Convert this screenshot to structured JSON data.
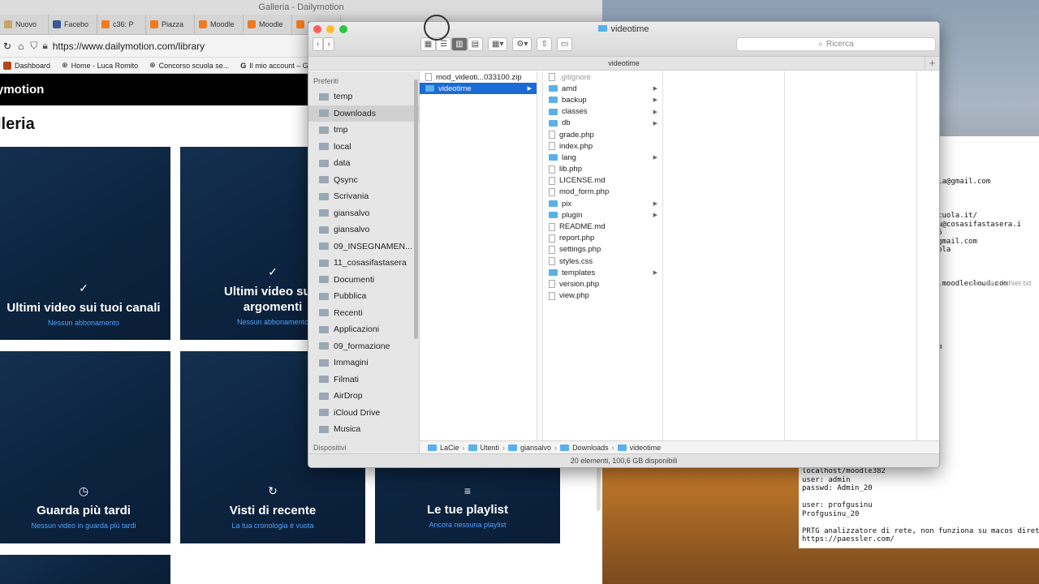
{
  "browser": {
    "window_title": "Galleria - Dailymotion",
    "tabs": [
      "Nuovo",
      "Facebo",
      "c36: P",
      "Piazza",
      "Moodle",
      "Moodle",
      "M"
    ],
    "url": "https://www.dailymotion.com/library",
    "bookmarks": [
      "Dashboard",
      "Home - Luca Romito",
      "Concorso scuola se...",
      "Il mio account – G"
    ],
    "brand": "ymotion",
    "page_title": "lleria",
    "cards": [
      {
        "icon": "✓",
        "title": "Ultimi video sui tuoi canali",
        "subtitle": "Nessun abbonamento"
      },
      {
        "icon": "✓",
        "title": "Ultimi video sui t argomenti",
        "subtitle": "Nessun abbonamento"
      },
      {
        "icon": "◷",
        "title": "Guarda più tardi",
        "subtitle": "Nessun video in guarda più tardi"
      },
      {
        "icon": "↻",
        "title": "Visti di recente",
        "subtitle": "La tua cronologia è vuota"
      },
      {
        "icon": "≡",
        "title": "Le tue playlist",
        "subtitle": "Ancora nessuna playlist"
      }
    ]
  },
  "finder": {
    "title": "videotime",
    "search_placeholder": "Ricerca",
    "path_header": "videotime",
    "sidebar_heading": "Preferiti",
    "sidebar_footer": "Dispositivi",
    "sidebar": [
      "temp",
      "Downloads",
      "tmp",
      "local",
      "data",
      "Qsync",
      "Scrivania",
      "giansalvo",
      "giansalvo",
      "09_INSEGNAMEN...",
      "11_cosasifastasera",
      "Documenti",
      "Pubblica",
      "Recenti",
      "Applicazioni",
      "09_formazione",
      "Immagini",
      "Filmati",
      "AirDrop",
      "iCloud Drive",
      "Musica"
    ],
    "col1": [
      {
        "name": "mod_videoti...033100.zip",
        "kind": "file"
      },
      {
        "name": "videotime",
        "kind": "folder"
      }
    ],
    "col2": [
      {
        "name": ".gitignore",
        "kind": "file"
      },
      {
        "name": "amd",
        "kind": "folder"
      },
      {
        "name": "backup",
        "kind": "folder"
      },
      {
        "name": "classes",
        "kind": "folder"
      },
      {
        "name": "db",
        "kind": "folder"
      },
      {
        "name": "grade.php",
        "kind": "file"
      },
      {
        "name": "index.php",
        "kind": "file"
      },
      {
        "name": "lang",
        "kind": "folder"
      },
      {
        "name": "lib.php",
        "kind": "file"
      },
      {
        "name": "LICENSE.md",
        "kind": "file"
      },
      {
        "name": "mod_form.php",
        "kind": "file"
      },
      {
        "name": "pix",
        "kind": "folder"
      },
      {
        "name": "plugin",
        "kind": "folder"
      },
      {
        "name": "README.md",
        "kind": "file"
      },
      {
        "name": "report.php",
        "kind": "file"
      },
      {
        "name": "settings.php",
        "kind": "file"
      },
      {
        "name": "styles.css",
        "kind": "file"
      },
      {
        "name": "templates",
        "kind": "folder"
      },
      {
        "name": "version.php",
        "kind": "file"
      },
      {
        "name": "view.php",
        "kind": "file"
      }
    ],
    "breadcrumb": [
      "LaCie",
      "Utenti",
      "giansalvo",
      "Downloads",
      "videotime"
    ],
    "status": "20 elementi, 100,6 GB disponibili"
  },
  "editor": {
    "lines_top": [
      "ascuola@gmail.com",
      "cuola",
      "",
      "",
      "epliscuola.it/",
      "gusinu@cosasifastasera.i",
      ".i2016",
      "gia3@gmail.com",
      "liscuola",
      "",
      "0 ***",
      "om",
      "gsinu.moodlecloud.com"
    ],
    "lines_mid": [
      "il.com"
    ],
    "lines_bottom": [
      "localhost/moodle382",
      "user: admin",
      "passwd: Admin_20",
      "",
      "user: profgusinu",
      "Profgusinu_20",
      "",
      "PRTG analizzatore di rete, non funziona su macos diretta",
      "https://paessler.com/"
    ],
    "file_label": "nouveau fichier.txt"
  }
}
